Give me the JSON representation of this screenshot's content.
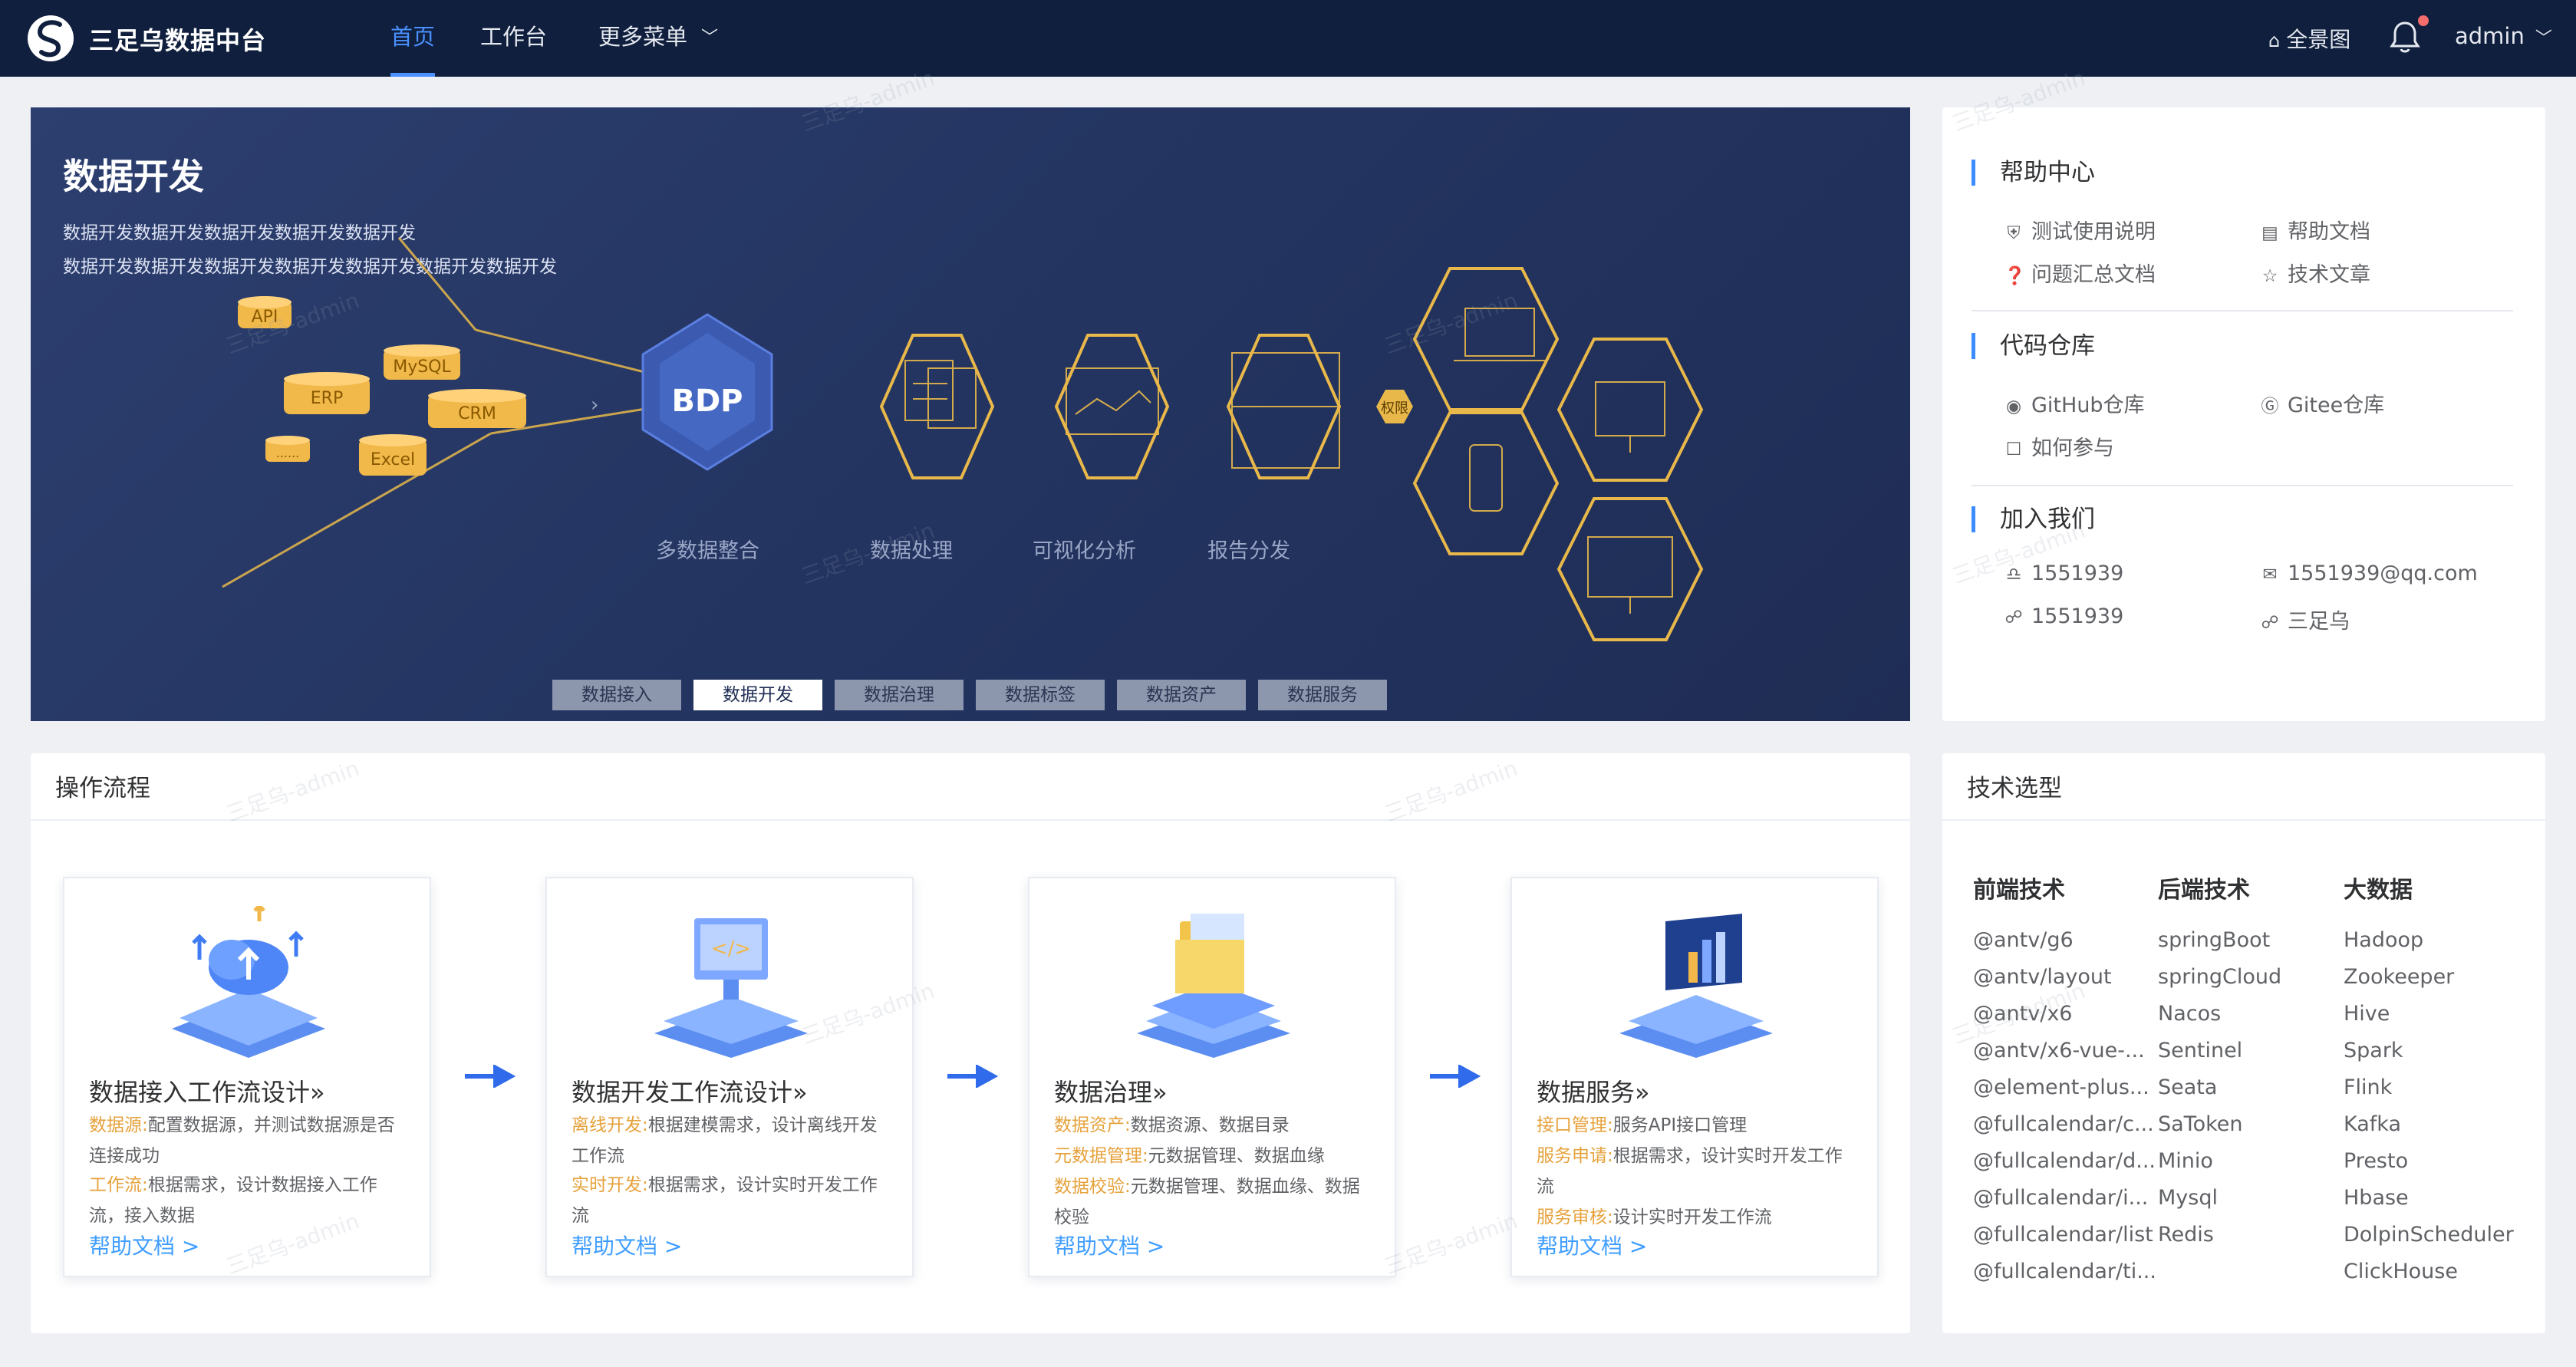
{
  "app": {
    "title": "三足乌数据中台"
  },
  "nav": [
    {
      "label": "首页",
      "active": true
    },
    {
      "label": "工作台"
    },
    {
      "label": "更多菜单"
    }
  ],
  "topright": {
    "overview": "全景图",
    "user": "admin"
  },
  "banner": {
    "title": "数据开发",
    "desc_line1": "数据开发数据开发数据开发数据开发数据开发",
    "desc_line2": "数据开发数据开发数据开发数据开发数据开发数据开发数据开发",
    "sources": [
      "API",
      "MySQL",
      "ERP",
      "CRM",
      "Excel",
      "......"
    ],
    "core": "BDP",
    "permission": "权限",
    "stages": [
      "多数据整合",
      "数据处理",
      "可视化分析",
      "报告分发"
    ],
    "tabs": [
      {
        "label": "数据接入"
      },
      {
        "label": "数据开发",
        "active": true
      },
      {
        "label": "数据治理"
      },
      {
        "label": "数据标签"
      },
      {
        "label": "数据资产"
      },
      {
        "label": "数据服务"
      }
    ]
  },
  "help": {
    "sections": [
      {
        "title": "帮助中心",
        "items": [
          {
            "icon": "shield-icon",
            "label": "测试使用说明"
          },
          {
            "icon": "document-icon",
            "label": "帮助文档"
          },
          {
            "icon": "question-icon",
            "label": "问题汇总文档"
          },
          {
            "icon": "star-icon",
            "label": "技术文章"
          }
        ]
      },
      {
        "title": "代码仓库",
        "items": [
          {
            "icon": "github-icon",
            "label": "GitHub仓库"
          },
          {
            "icon": "gitee-icon",
            "label": "Gitee仓库"
          },
          {
            "icon": "chat-icon",
            "label": "如何参与"
          }
        ]
      },
      {
        "title": "加入我们",
        "items": [
          {
            "icon": "qq-icon",
            "label": "1551939"
          },
          {
            "icon": "mail-icon",
            "label": "1551939@qq.com"
          },
          {
            "icon": "wechat-icon",
            "label": "1551939"
          },
          {
            "icon": "wechat-icon",
            "label": "三足乌"
          }
        ]
      }
    ]
  },
  "flow": {
    "title": "操作流程",
    "cards": [
      {
        "title": "数据接入工作流设计",
        "mark": "»",
        "lines": [
          {
            "k": "数据源:",
            "v": "配置数据源，并测试数据源是否连接成功"
          },
          {
            "k": "工作流:",
            "v": "根据需求，设计数据接入工作流，接入数据"
          }
        ],
        "link": "帮助文档"
      },
      {
        "title": "数据开发工作流设计",
        "mark": "»",
        "lines": [
          {
            "k": "离线开发:",
            "v": "根据建模需求，设计离线开发工作流"
          },
          {
            "k": "实时开发:",
            "v": "根据需求，设计实时开发工作流"
          }
        ],
        "link": "帮助文档"
      },
      {
        "title": "数据治理",
        "mark": "»",
        "lines": [
          {
            "k": "数据资产:",
            "v": "数据资源、数据目录"
          },
          {
            "k": "元数据管理:",
            "v": "元数据管理、数据血缘"
          },
          {
            "k": "数据校验:",
            "v": "元数据管理、数据血缘、数据校验"
          }
        ],
        "link": "帮助文档"
      },
      {
        "title": "数据服务",
        "mark": "»",
        "lines": [
          {
            "k": "接口管理:",
            "v": "服务API接口管理"
          },
          {
            "k": "服务申请:",
            "v": "根据需求，设计实时开发工作流"
          },
          {
            "k": "服务审核:",
            "v": "设计实时开发工作流"
          }
        ],
        "link": "帮助文档"
      }
    ]
  },
  "tech": {
    "title": "技术选型",
    "columns": [
      {
        "head": "前端技术",
        "items": [
          "@antv/g6",
          "@antv/layout",
          "@antv/x6",
          "@antv/x6-vue-...",
          "@element-plus...",
          "@fullcalendar/c...",
          "@fullcalendar/d...",
          "@fullcalendar/i...",
          "@fullcalendar/list",
          "@fullcalendar/ti..."
        ]
      },
      {
        "head": "后端技术",
        "items": [
          "springBoot",
          "springCloud",
          "Nacos",
          "Sentinel",
          "Seata",
          "SaToken",
          "Minio",
          "Mysql",
          "Redis"
        ]
      },
      {
        "head": "大数据",
        "items": [
          "Hadoop",
          "Zookeeper",
          "Hive",
          "Spark",
          "Flink",
          "Kafka",
          "Presto",
          "Hbase",
          "DolpinScheduler",
          "ClickHouse"
        ]
      }
    ]
  },
  "watermark": "三足乌-admin",
  "colors": {
    "topbar": "#0f1f3d",
    "accent": "#4a90ff",
    "banner": "#243562",
    "hexagon": "#e8b84a",
    "key_orange": "#e6a23c",
    "link": "#409eff"
  }
}
